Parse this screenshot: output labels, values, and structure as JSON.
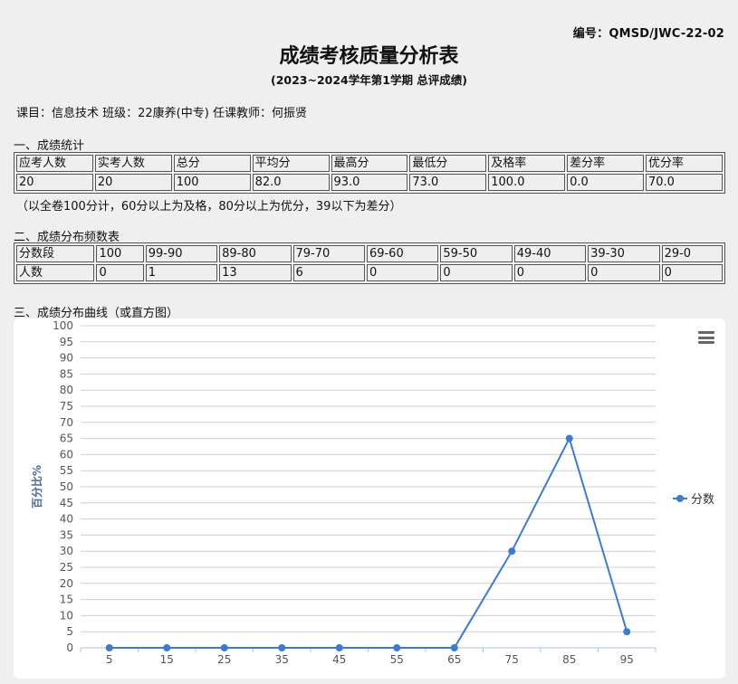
{
  "doc_no": "编号：QMSD/JWC-22-02",
  "title": "成绩考核质量分析表",
  "subtitle": "(2023~2024学年第1学期  总评成绩)",
  "meta": "课目：信息技术 班级：22康养(中专) 任课教师：何振贤",
  "section1": {
    "heading": "一、成绩统计",
    "headers": [
      "应考人数",
      "实考人数",
      "总分",
      "平均分",
      "最高分",
      "最低分",
      "及格率",
      "差分率",
      "优分率"
    ],
    "values": [
      "20",
      "20",
      "100",
      "82.0",
      "93.0",
      "73.0",
      "100.0",
      "0.0",
      "70.0"
    ],
    "note": "（以全卷100分计，60分以上为及格，80分以上为优分，39以下为差分）"
  },
  "section2": {
    "heading": "二、成绩分布频数表",
    "row1": [
      "分数段",
      "100",
      "99-90",
      "89-80",
      "79-70",
      "69-60",
      "59-50",
      "49-40",
      "39-30",
      "29-0"
    ],
    "row2": [
      "人数",
      "0",
      "1",
      "13",
      "6",
      "0",
      "0",
      "0",
      "0",
      "0"
    ]
  },
  "section3": {
    "heading": "三、成绩分布曲线（或直方图）"
  },
  "chart_data": {
    "type": "line",
    "x": [
      "5",
      "15",
      "25",
      "35",
      "45",
      "55",
      "65",
      "75",
      "85",
      "95"
    ],
    "series": [
      {
        "name": "分数",
        "values": [
          0,
          0,
          0,
          0,
          0,
          0,
          0,
          30,
          65,
          5
        ]
      }
    ],
    "ylabel": "百分比%",
    "xlabel": "",
    "ylim": [
      0,
      100
    ],
    "yticks": [
      0,
      5,
      10,
      15,
      20,
      25,
      30,
      35,
      40,
      45,
      50,
      55,
      60,
      65,
      70,
      75,
      80,
      85,
      90,
      95,
      100
    ],
    "grid": true,
    "legend": "right",
    "color": "#3a7bd5"
  }
}
